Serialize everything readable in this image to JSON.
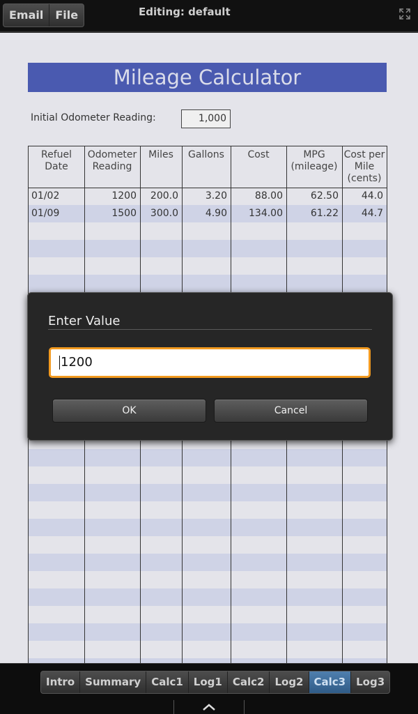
{
  "topbar": {
    "menu": [
      "Email",
      "File"
    ],
    "title": "Editing: default",
    "expand_icon": "expand-icon"
  },
  "sheet": {
    "title": "Mileage Calculator",
    "odometer_label": "Initial Odometer Reading:",
    "odometer_value": "1,000",
    "headers": [
      [
        "Refuel",
        "Date"
      ],
      [
        "Odometer",
        "Reading"
      ],
      [
        "Miles"
      ],
      [
        "Gallons"
      ],
      [
        "Cost"
      ],
      [
        "MPG",
        "(mileage)"
      ],
      [
        "Cost per",
        "Mile",
        "(cents)"
      ]
    ],
    "rows": [
      [
        "01/02",
        "1200",
        "200.0",
        "3.20",
        "88.00",
        "62.50",
        "44.0"
      ],
      [
        "01/09",
        "1500",
        "300.0",
        "4.90",
        "134.00",
        "61.22",
        "44.7"
      ]
    ]
  },
  "dialog": {
    "title": "Enter Value",
    "input_value": "1200",
    "ok_label": "OK",
    "cancel_label": "Cancel"
  },
  "tabs": {
    "items": [
      "Intro",
      "Summary",
      "Calc1",
      "Log1",
      "Calc2",
      "Log2",
      "Calc3",
      "Log3"
    ],
    "active": "Calc3"
  },
  "colors": {
    "title_band": "#4a5ab0",
    "stripe": "#cfd3e6",
    "input_focus": "#f29a20",
    "active_tab": "#3d6c9b"
  }
}
